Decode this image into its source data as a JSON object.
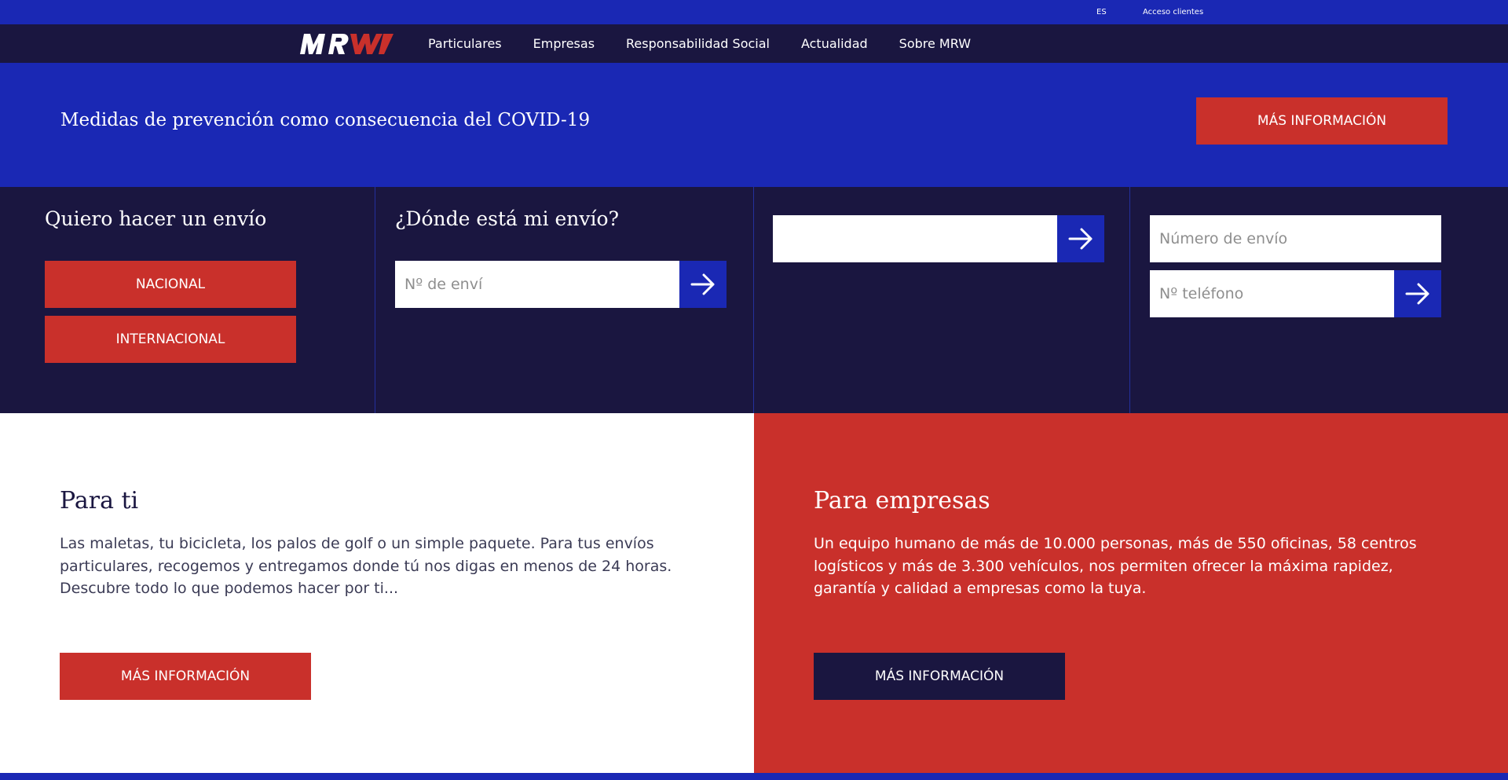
{
  "topbar": {
    "language": "ES",
    "client_access": "Acceso clientes"
  },
  "brand": {
    "logo_text": "MRW",
    "logo_icon": "mrw-logo",
    "colors": {
      "blue": "#1a28b4",
      "navy": "#1a1640",
      "red": "#c9302b"
    }
  },
  "nav": {
    "items": [
      {
        "label": "Particulares"
      },
      {
        "label": "Empresas"
      },
      {
        "label": "Responsabilidad Social"
      },
      {
        "label": "Actualidad"
      },
      {
        "label": "Sobre MRW"
      }
    ]
  },
  "covid_banner": {
    "text": "Medidas de prevención como consecuencia del COVID-19",
    "button": "MÁS INFORMACIÓN"
  },
  "send": {
    "title": "Quiero hacer un envío",
    "national": "NACIONAL",
    "international": "INTERNACIONAL"
  },
  "track": {
    "title": "¿Dónde está mi envío?",
    "placeholder": "Nº de enví",
    "submit_icon": "arrow-right-icon"
  },
  "search": {
    "placeholder": "",
    "submit_icon": "arrow-right-icon"
  },
  "phone_track": {
    "number_placeholder": "Número de envío",
    "phone_placeholder": "Nº teléfono",
    "submit_icon": "arrow-right-icon"
  },
  "for_you": {
    "title": "Para ti",
    "text": "Las maletas, tu bicicleta, los palos de golf o un simple paquete. Para tus envíos particulares, recogemos y entregamos donde tú nos digas en menos de 24 horas. Descubre todo lo que podemos hacer por ti...",
    "button": "MÁS INFORMACIÓN"
  },
  "for_business": {
    "title": "Para empresas",
    "text": "Un equipo humano de más de 10.000 personas, más de 550 oficinas, 58 centros logísticos y más de 3.300 vehículos, nos permiten ofrecer la máxima rapidez, garantía y calidad a empresas como la tuya.",
    "button": "MÁS INFORMACIÓN"
  }
}
